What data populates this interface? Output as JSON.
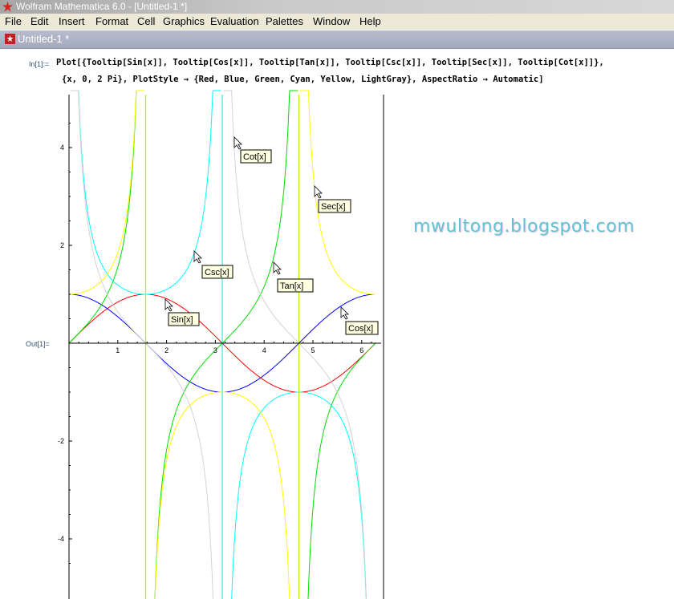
{
  "window": {
    "title": "Wolfram Mathematica 6.0 - [Untitled-1 *]"
  },
  "menu": [
    "File",
    "Edit",
    "Insert",
    "Format",
    "Cell",
    "Graphics",
    "Evaluation",
    "Palettes",
    "Window",
    "Help"
  ],
  "notebook": {
    "title": "Untitled-1 *",
    "input_label": "In[1]:=",
    "output_label": "Out[1]=",
    "input_line1": "Plot[{Tooltip[Sin[x]], Tooltip[Cos[x]], Tooltip[Tan[x]], Tooltip[Csc[x]], Tooltip[Sec[x]], Tooltip[Cot[x]]},",
    "input_line2": "{x, 0, 2 Pi}, PlotStyle → {Red, Blue, Green, Cyan, Yellow, LightGray}, AspectRatio → Automatic]"
  },
  "watermark": "mwultong.blogspot.com",
  "chart_data": {
    "type": "line",
    "title": "",
    "xlabel": "",
    "ylabel": "",
    "xlim": [
      0,
      6.2832
    ],
    "ylim": [
      -5,
      5
    ],
    "x_ticks": [
      "1",
      "2",
      "3",
      "4",
      "5",
      "6"
    ],
    "y_ticks": [
      "4",
      "2",
      "-2",
      "-4"
    ],
    "series": [
      {
        "fn": "sin",
        "color": "#ff0000"
      },
      {
        "fn": "cos",
        "color": "#0000ff"
      },
      {
        "fn": "tan",
        "color": "#00dd00"
      },
      {
        "fn": "csc",
        "color": "#00ffff"
      },
      {
        "fn": "sec",
        "color": "#ffff00"
      },
      {
        "fn": "cot",
        "color": "#d3d3d3"
      }
    ],
    "tooltips": [
      "Cot[x]",
      "Sec[x]",
      "Csc[x]",
      "Tan[x]",
      "Sin[x]",
      "Cos[x]"
    ]
  }
}
